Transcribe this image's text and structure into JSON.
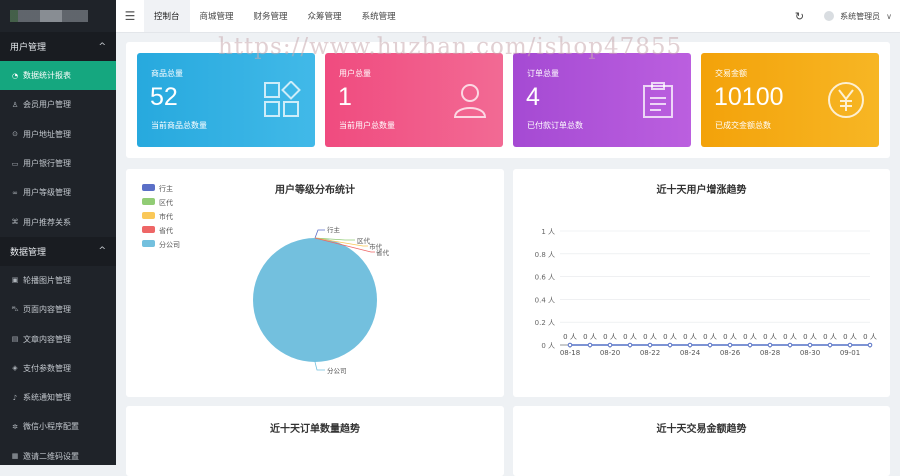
{
  "sidebar": {
    "groups": [
      {
        "label": "用户管理",
        "chevron": "^",
        "items": [
          {
            "label": "数据统计报表",
            "icon": "chart-icon",
            "glyph": "◔",
            "active": true
          },
          {
            "label": "会员用户管理",
            "icon": "user-icon",
            "glyph": "♙"
          },
          {
            "label": "用户地址管理",
            "icon": "location-icon",
            "glyph": "⊙"
          },
          {
            "label": "用户银行管理",
            "icon": "card-icon",
            "glyph": "▭"
          },
          {
            "label": "用户等级管理",
            "icon": "link-icon",
            "glyph": "∞"
          },
          {
            "label": "用户推荐关系",
            "icon": "relation-icon",
            "glyph": "⌘"
          }
        ]
      },
      {
        "label": "数据管理",
        "chevron": "^",
        "items": [
          {
            "label": "轮播图片管理",
            "icon": "image-icon",
            "glyph": "▣"
          },
          {
            "label": "页面内容管理",
            "icon": "car-icon",
            "glyph": "⛍"
          },
          {
            "label": "文章内容管理",
            "icon": "article-icon",
            "glyph": "▤"
          },
          {
            "label": "支付参数管理",
            "icon": "shield-icon",
            "glyph": "◈"
          },
          {
            "label": "系统通知管理",
            "icon": "bell-icon",
            "glyph": "♪"
          },
          {
            "label": "微信小程序配置",
            "icon": "settings-icon",
            "glyph": "✲"
          },
          {
            "label": "邀请二维码设置",
            "icon": "qrcode-icon",
            "glyph": "▦"
          }
        ]
      }
    ]
  },
  "topbar": {
    "menu_toggle": "☰",
    "tabs": [
      {
        "label": "控制台",
        "active": true
      },
      {
        "label": "商城管理"
      },
      {
        "label": "财务管理"
      },
      {
        "label": "众筹管理"
      },
      {
        "label": "系统管理"
      }
    ],
    "refresh_glyph": "↻",
    "user": "系统管理员",
    "caret": "∨"
  },
  "watermark": "https://www.huzhan.com/ishop47855",
  "stats": [
    {
      "label": "商品总量",
      "value": "52",
      "sub": "当前商品总数量",
      "icon": "grid-icon"
    },
    {
      "label": "用户总量",
      "value": "1",
      "sub": "当前用户总数量",
      "icon": "users-icon"
    },
    {
      "label": "订单总量",
      "value": "4",
      "sub": "已付款订单总数",
      "icon": "clipboard-icon"
    },
    {
      "label": "交易金额",
      "value": "10100",
      "sub": "已成交金额总数",
      "icon": "yen-icon"
    }
  ],
  "cards": {
    "pie_title": "用户等级分布统计",
    "line_title": "近十天用户增涨趋势",
    "orders_title": "近十天订单数量趋势",
    "amount_title": "近十天交易金额趋势"
  },
  "chart_data": [
    {
      "type": "pie",
      "title": "用户等级分布统计",
      "legend_position": "top-left",
      "categories": [
        "行主",
        "区代",
        "市代",
        "省代",
        "分公司"
      ],
      "values": [
        0,
        0,
        0,
        0,
        1
      ],
      "colors": [
        "#5b6fc7",
        "#91cc75",
        "#fac858",
        "#ee6666",
        "#73c0de"
      ]
    },
    {
      "type": "line",
      "title": "近十天用户增涨趋势",
      "x": [
        "08-18",
        "08-19",
        "08-20",
        "08-21",
        "08-22",
        "08-23",
        "08-24",
        "08-25",
        "08-26",
        "08-27",
        "08-28",
        "08-29",
        "08-30",
        "08-31",
        "09-01",
        "09-02"
      ],
      "x_tick_labels": [
        "08-18",
        "08-20",
        "08-22",
        "08-24",
        "08-26",
        "08-28",
        "08-30",
        "09-01"
      ],
      "y": [
        0,
        0,
        0,
        0,
        0,
        0,
        0,
        0,
        0,
        0,
        0,
        0,
        0,
        0,
        0,
        0
      ],
      "point_label": "0 人",
      "ylim": [
        0,
        1
      ],
      "y_ticks": [
        "0 人",
        "0.2 人",
        "0.4 人",
        "0.6 人",
        "0.8 人",
        "1 人"
      ],
      "grid": true,
      "color": "#5470c6"
    }
  ]
}
